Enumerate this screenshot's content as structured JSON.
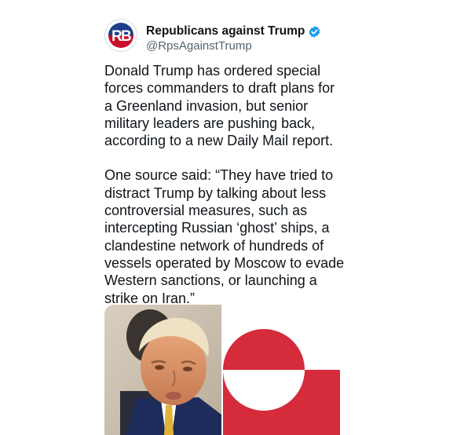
{
  "account": {
    "display_name": "Republicans against Trump",
    "handle": "@RpsAgainstTrump",
    "avatar_initials": "RB",
    "verified": true,
    "verified_color": "#1d9bf0"
  },
  "tweet": {
    "paragraph_1": "Donald Trump has ordered special\nforces commanders to draft plans for\na Greenland invasion, but senior\nmilitary leaders are pushing back,\naccording to a new Daily Mail report.",
    "paragraph_2": "One source said: “They have tried to\ndistract Trump by talking about less\ncontroversial measures, such as\nintercepting Russian ‘ghost’ ships, a\nclandestine network of hundreds of\nvessels operated by Moscow to evade\nWestern sanctions, or launching a\nstrike on Iran.”"
  },
  "media": {
    "image_1": "photo of Donald Trump",
    "image_2": "flag of Greenland",
    "flag_colors": {
      "red": "#d52b3b",
      "white": "#ffffff"
    }
  }
}
